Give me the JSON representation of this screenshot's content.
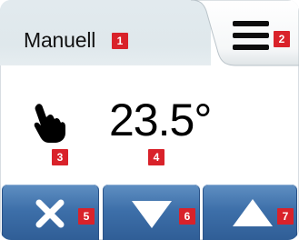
{
  "header": {
    "mode_label": "Manuell",
    "mode_badge": "1",
    "menu_badge": "2",
    "menu_icon": "hamburger-menu-icon"
  },
  "main": {
    "mode_icon": "hand-pointer-icon",
    "mode_icon_badge": "3",
    "temperature": "23.5°",
    "temperature_badge": "4"
  },
  "buttons": [
    {
      "icon": "close-x-icon",
      "badge": "5"
    },
    {
      "icon": "triangle-down-icon",
      "badge": "6"
    },
    {
      "icon": "triangle-up-icon",
      "badge": "7"
    }
  ],
  "colors": {
    "badge": "#d9222a",
    "button": "#3d6fa9",
    "header": "#e2eaee"
  }
}
